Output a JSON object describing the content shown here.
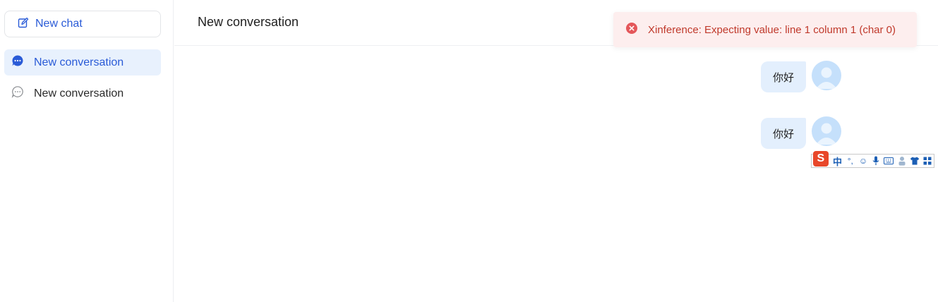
{
  "sidebar": {
    "new_chat_label": "New chat",
    "conversations": [
      {
        "label": "New conversation",
        "active": true
      },
      {
        "label": "New conversation",
        "active": false
      }
    ]
  },
  "header": {
    "title": "New conversation"
  },
  "toast": {
    "message": "Xinference: Expecting value: line 1 column 1 (char 0)",
    "icon": "error-circle-icon"
  },
  "messages": [
    {
      "role": "user",
      "text": "你好"
    },
    {
      "role": "user",
      "text": "你好"
    }
  ],
  "ime_toolbar": {
    "logo": "S",
    "items": [
      "中",
      "°,",
      "☺",
      "mic-icon",
      "keyboard-icon",
      "user-icon",
      "shirt-icon",
      "grid-icon"
    ]
  },
  "colors": {
    "accent": "#2a5bd7",
    "active_bg": "#e8f1fd",
    "bubble_bg": "#e3effd",
    "toast_bg": "#fdeeee",
    "toast_text": "#c0392b",
    "error_icon": "#e4575a"
  }
}
